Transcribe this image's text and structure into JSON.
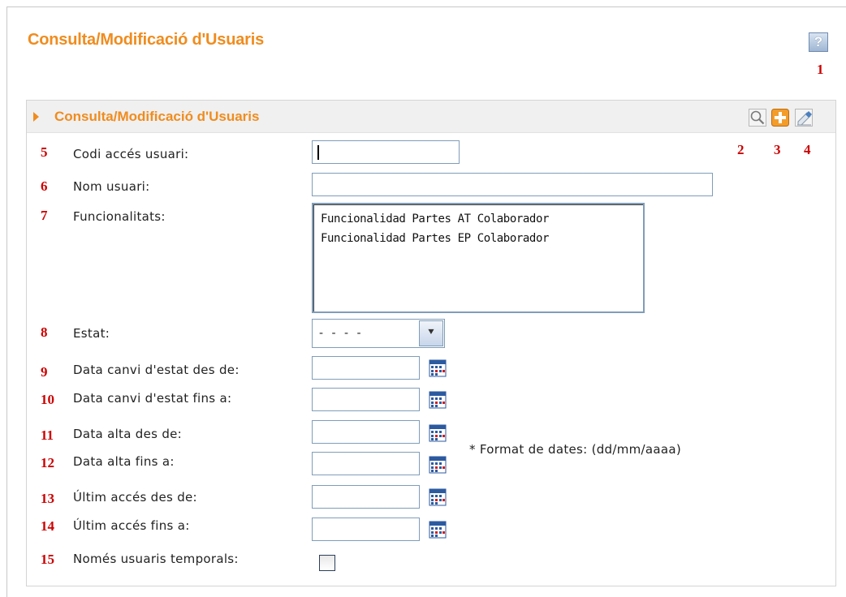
{
  "page": {
    "title": "Consulta/Modificació d'Usuaris",
    "help_label": "?"
  },
  "callouts": {
    "n1": "1",
    "n2": "2",
    "n3": "3",
    "n4": "4",
    "n5": "5",
    "n6": "6",
    "n7": "7",
    "n8": "8",
    "n9": "9",
    "n10": "10",
    "n11": "11",
    "n12": "12",
    "n13": "13",
    "n14": "14",
    "n15": "15"
  },
  "panel": {
    "title": "Consulta/Modificació d'Usuaris",
    "tools": [
      "search-icon",
      "add-icon",
      "clear-icon"
    ]
  },
  "form": {
    "codi_label": "Codi accés usuari:",
    "codi_value": "",
    "nom_label": "Nom usuari:",
    "nom_value": "",
    "func_label": "Funcionalitats:",
    "func_items": [
      "Funcionalidad Partes AT Colaborador",
      "Funcionalidad Partes EP Colaborador"
    ],
    "estat_label": "Estat:",
    "estat_value": "- - - -",
    "canvi_desde_label": "Data canvi d'estat des de:",
    "canvi_fins_label": "Data canvi d'estat fins a:",
    "alta_desde_label": "Data alta des de:",
    "alta_fins_label": "Data alta fins a:",
    "acces_desde_label": "Últim accés des de:",
    "acces_fins_label": "Últim accés fins a:",
    "temporals_label": "Només usuaris temporals:",
    "temporals_checked": false,
    "date_note": "* Format de dates: (dd/mm/aaaa)"
  },
  "colors": {
    "accent": "#f08c1e",
    "callout": "#cc0000",
    "input_border": "#7f9db9"
  }
}
